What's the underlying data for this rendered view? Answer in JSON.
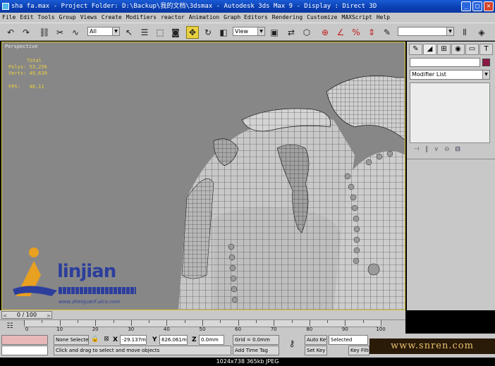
{
  "title": {
    "text": "sha fa.max     - Project Folder: D:\\Backup\\我的文档\\3dsmax     - Autodesk 3ds Max 9     - Display : Direct 3D"
  },
  "window_buttons": [
    "_",
    "□",
    "✕"
  ],
  "menu": [
    "File",
    "Edit",
    "Tools",
    "Group",
    "Views",
    "Create",
    "Modifiers",
    "reactor",
    "Animation",
    "Graph Editors",
    "Rendering",
    "Customize",
    "MAXScript",
    "Help"
  ],
  "toolbar": {
    "selection_filter": "All",
    "ref_coord": "View"
  },
  "viewport": {
    "label": "Perspective",
    "stats": {
      "header": "Total",
      "polys_label": "Polys:",
      "polys_value": "53,256",
      "verts_label": "Verts:",
      "verts_value": "49,639",
      "fps_label": "FPS:",
      "fps_value": "48.11"
    },
    "logo": {
      "word": "linjian",
      "url": "www.zhenjuanf.ulco.com"
    }
  },
  "command_panel": {
    "modifier_list": "Modifier List"
  },
  "time_slider": {
    "position": "0 / 100",
    "prev": "<",
    "next": ">"
  },
  "trackbar": {
    "labels": [
      "0",
      "10",
      "20",
      "30",
      "40",
      "50",
      "60",
      "70",
      "80",
      "90",
      "100"
    ]
  },
  "status": {
    "selection": "None Selecte",
    "x_label": "X",
    "x_value": "-29.137mm",
    "y_label": "Y",
    "y_value": "626.061mm",
    "z_label": "Z",
    "z_value": "0.0mm",
    "grid": "Grid = 0.0mm",
    "auto_key": "Auto Key",
    "selected": "Selected",
    "set_key": "Set Key",
    "key_filters": "Key Filte",
    "add_time_tag": "Add Time Tag",
    "prompt": "Click and drag to select and move objects"
  },
  "watermark": "www.snren.com",
  "image_info": "1024x738  365kb  JPEG",
  "colors": {
    "viewport_bg": "#878787",
    "stats_text": "#e8d040",
    "active_border": "#d9c82a",
    "object_color": "#8c1846"
  },
  "icons": [
    "undo-icon",
    "redo-icon",
    "link-icon",
    "unlink-icon",
    "bind-space-warp-icon",
    "select-icon",
    "select-by-name-icon",
    "rect-region-icon",
    "window-crossing-icon",
    "move-icon",
    "rotate-icon",
    "scale-icon",
    "pivot-icon",
    "mirror-icon",
    "align-icon",
    "snap-icon",
    "angle-snap-icon",
    "percent-snap-icon",
    "spinner-snap-icon",
    "named-selection-icon",
    "material-editor-icon",
    "render-icon",
    "key-icon"
  ]
}
